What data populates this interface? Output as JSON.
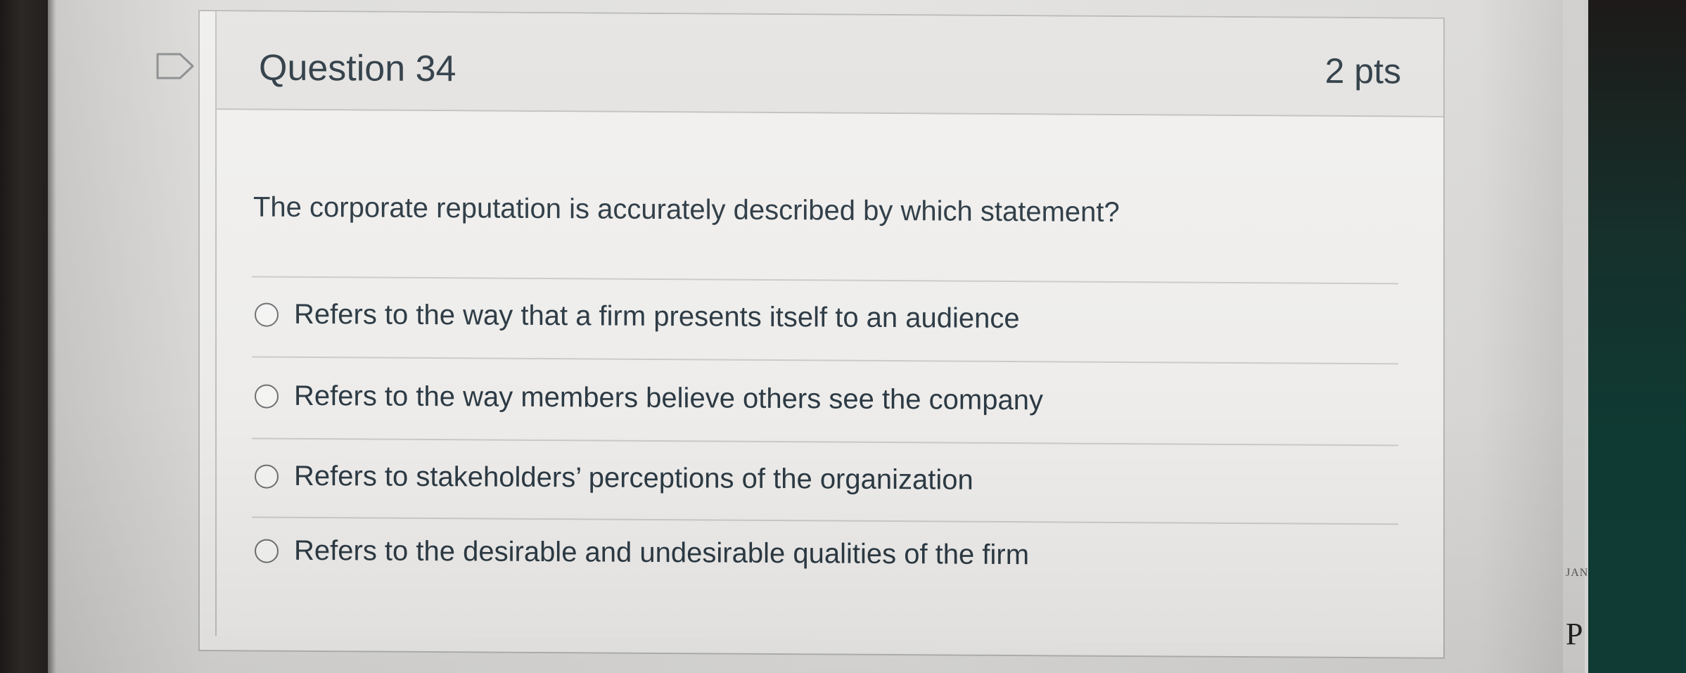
{
  "question": {
    "title": "Question 34",
    "points": "2 pts",
    "text": "The corporate reputation is accurately described by which statement?",
    "answers": [
      {
        "label": "Refers to the way that a firm presents itself to an audience"
      },
      {
        "label": "Refers to the way members believe others see the company"
      },
      {
        "label": "Refers to stakeholders’ perceptions of the organization"
      },
      {
        "label": "Refers to the desirable and undesirable qualities of the firm"
      }
    ]
  },
  "background": {
    "side_text_1": "JAN",
    "side_text_2": "P"
  },
  "icons": {
    "flag": "flag-outline-icon",
    "radio": "radio-unselected-icon"
  },
  "colors": {
    "text": "#2d3b45",
    "header_bg": "#e5e4e2",
    "border": "#c3c2c0"
  }
}
